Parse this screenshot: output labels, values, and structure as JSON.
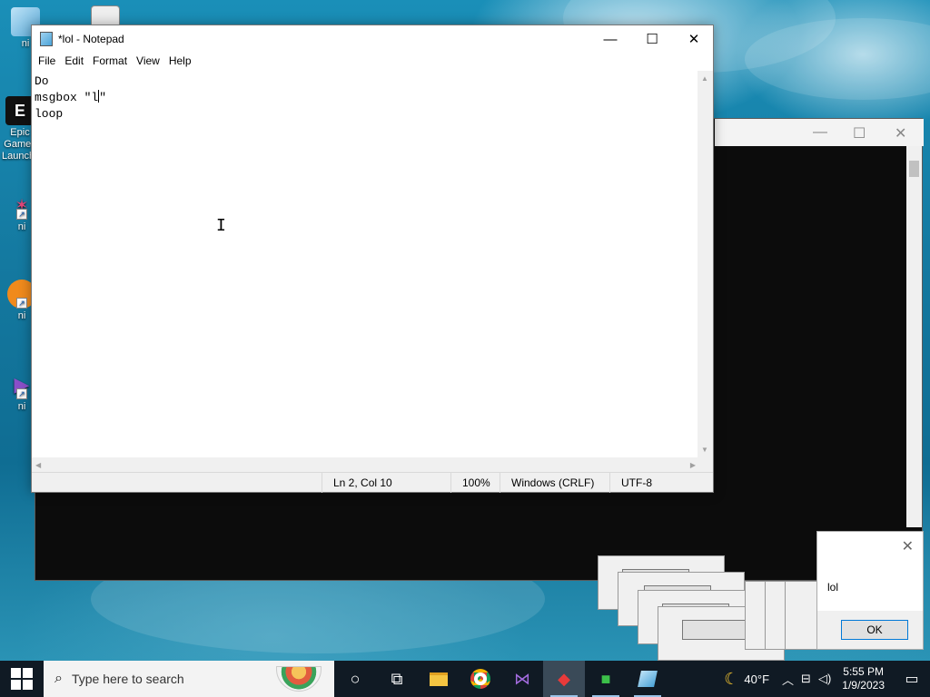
{
  "notepad": {
    "title": "*lol - Notepad",
    "menu": [
      "File",
      "Edit",
      "Format",
      "View",
      "Help"
    ],
    "lines": [
      "Do",
      "msgbox \"l",
      "\"",
      "loop"
    ],
    "status": {
      "position": "Ln 2, Col 10",
      "zoom": "100%",
      "line_ending": "Windows (CRLF)",
      "encoding": "UTF-8"
    }
  },
  "message_box": {
    "text": "lol",
    "ok_label": "OK"
  },
  "message_box_stack": {
    "ok_label": "OK"
  },
  "desktop_icons": [
    {
      "label": "ni",
      "icon": "recycle-bin-icon"
    },
    {
      "label": "Epic Games Launcher",
      "icon": "epic-games-icon"
    },
    {
      "label": "ni",
      "icon": "app-shortcut-icon"
    },
    {
      "label": "ni",
      "icon": "app-shortcut-icon"
    },
    {
      "label": "ni",
      "icon": "visual-studio-icon"
    }
  ],
  "taskbar": {
    "search_placeholder": "Type here to search",
    "pinned": [
      "cortana-icon",
      "task-view-icon",
      "file-explorer-icon",
      "chrome-icon",
      "visual-studio-icon",
      "app-icon",
      "app-icon",
      "notepad-icon"
    ],
    "weather": "40°F",
    "time": "5:55 PM",
    "date": "1/9/2023"
  }
}
